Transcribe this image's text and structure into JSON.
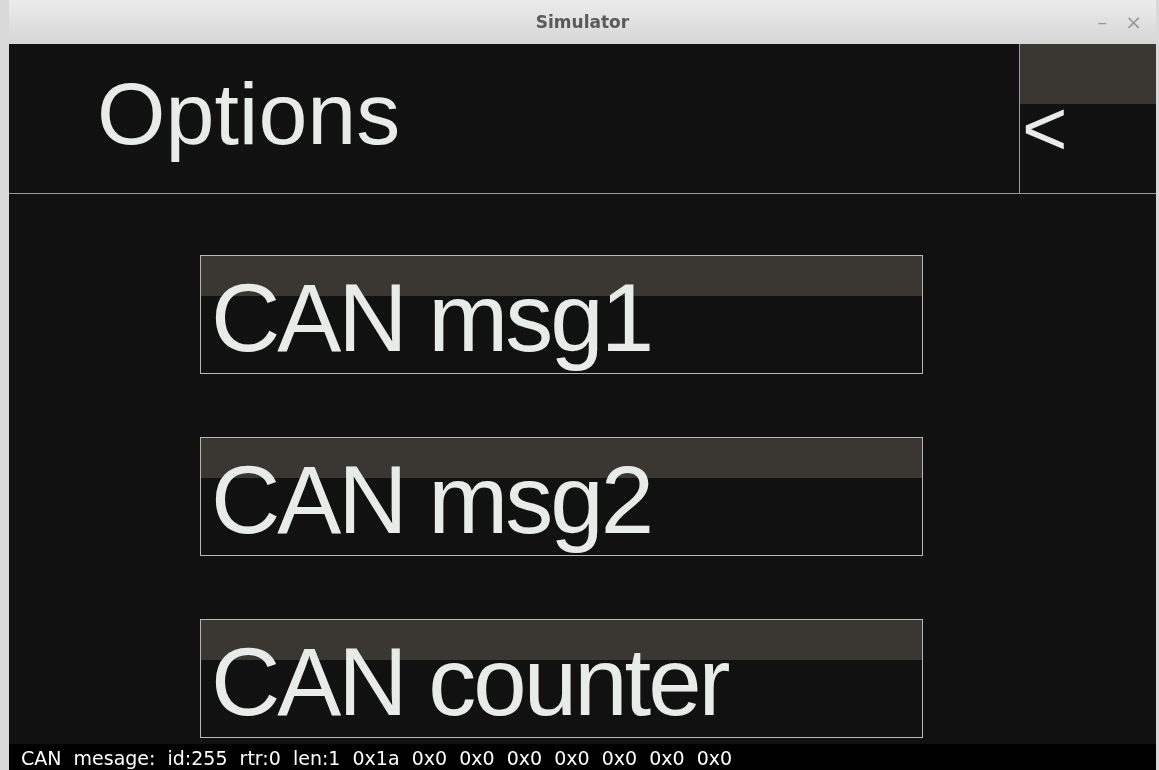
{
  "window": {
    "title": "Simulator",
    "controls": [
      "–",
      "×"
    ]
  },
  "header": {
    "title": "Options",
    "back_button": "<"
  },
  "buttons": [
    {
      "label": "CAN msg1"
    },
    {
      "label": "CAN msg2"
    },
    {
      "label": "CAN counter"
    }
  ],
  "status_bar": "CAN  mesage:  id:255  rtr:0  len:1  0x1a  0x0  0x0  0x0  0x0  0x0  0x0  0x0"
}
